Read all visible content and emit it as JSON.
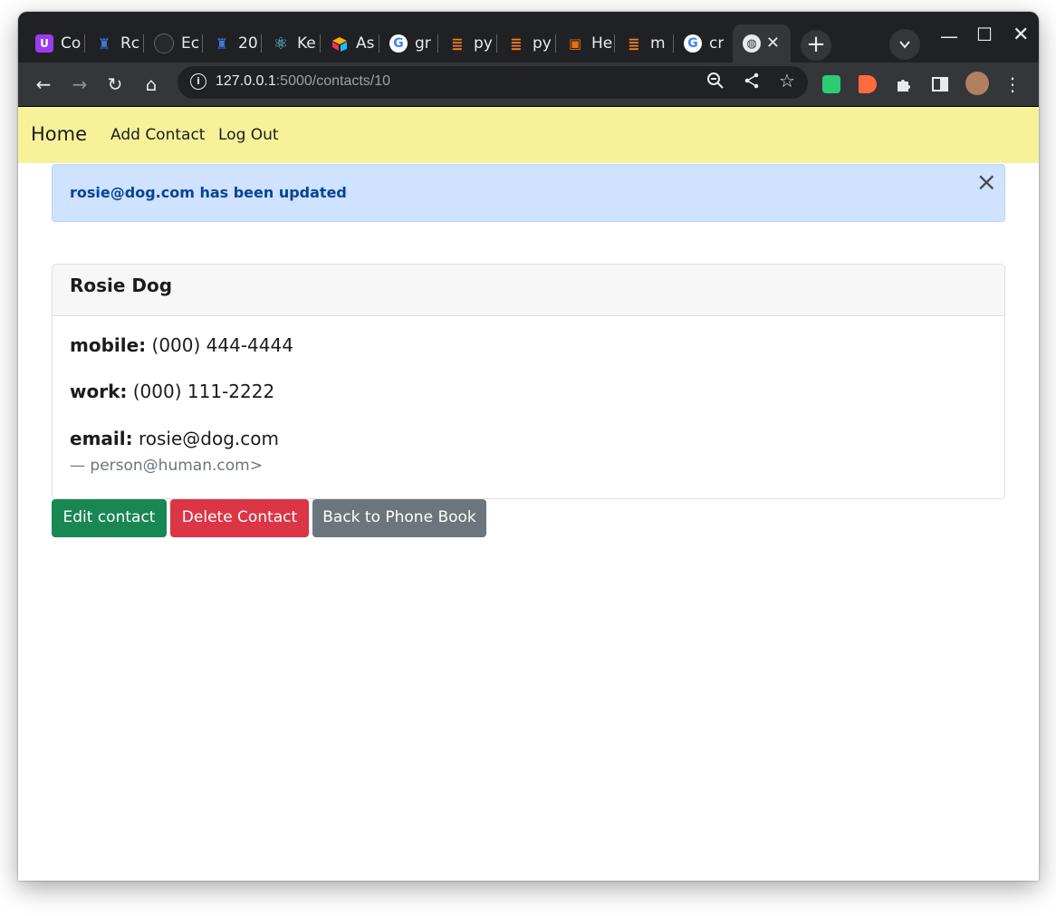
{
  "browser": {
    "tabs": [
      {
        "title": "Co",
        "icon": "u-icon",
        "color": "#9b3cf0",
        "glyph": "U"
      },
      {
        "title": "Rc",
        "icon": "python-bottle-icon",
        "color": "#3b7bd6",
        "glyph": "♜"
      },
      {
        "title": "Ec",
        "icon": "github-icon",
        "color": "#24292e",
        "glyph": "●"
      },
      {
        "title": "20",
        "icon": "python-bottle-icon",
        "color": "#3b7bd6",
        "glyph": "♜"
      },
      {
        "title": "Ke",
        "icon": "react-icon",
        "color": "#202124",
        "glyph": "⚛"
      },
      {
        "title": "As",
        "icon": "airtable-icon",
        "color": "#f2b61c",
        "glyph": "◆"
      },
      {
        "title": "gr",
        "icon": "google-icon",
        "color": "#ffffff",
        "glyph": "G"
      },
      {
        "title": "py",
        "icon": "stackoverflow-icon",
        "color": "#202124",
        "glyph": "≡"
      },
      {
        "title": "py",
        "icon": "stackoverflow-icon",
        "color": "#202124",
        "glyph": "≡"
      },
      {
        "title": "He",
        "icon": "person-icon",
        "color": "#e8710a",
        "glyph": "▣"
      },
      {
        "title": "m",
        "icon": "stackoverflow-icon",
        "color": "#202124",
        "glyph": "≡"
      },
      {
        "title": "cr",
        "icon": "google-icon",
        "color": "#ffffff",
        "glyph": "G"
      },
      {
        "title": "",
        "icon": "globe-icon",
        "color": "#35363a",
        "glyph": "🌐"
      }
    ],
    "new_tab": "+",
    "url_host": "127.0.0.1",
    "url_rest": ":5000/contacts/10"
  },
  "nav": {
    "brand": "Home",
    "links": [
      "Add Contact",
      "Log Out"
    ]
  },
  "alert": {
    "message": "rosie@dog.com has been updated",
    "close": "×"
  },
  "contact": {
    "name": "Rosie Dog",
    "mobile_label": "mobile:",
    "mobile": "(000) 444-4444",
    "work_label": "work:",
    "work": "(000) 111-2222",
    "email_label": "email:",
    "email": "rosie@dog.com",
    "owner": "— person@human.com>"
  },
  "buttons": {
    "edit": "Edit contact",
    "delete": "Delete Contact",
    "back": "Back to Phone Book"
  },
  "colors": {
    "navbar_bg": "#f7f29a",
    "alert_bg": "#cfe2ff",
    "alert_text": "#084298",
    "edit_bg": "#198754",
    "delete_bg": "#dc3545",
    "back_bg": "#6c757d"
  }
}
